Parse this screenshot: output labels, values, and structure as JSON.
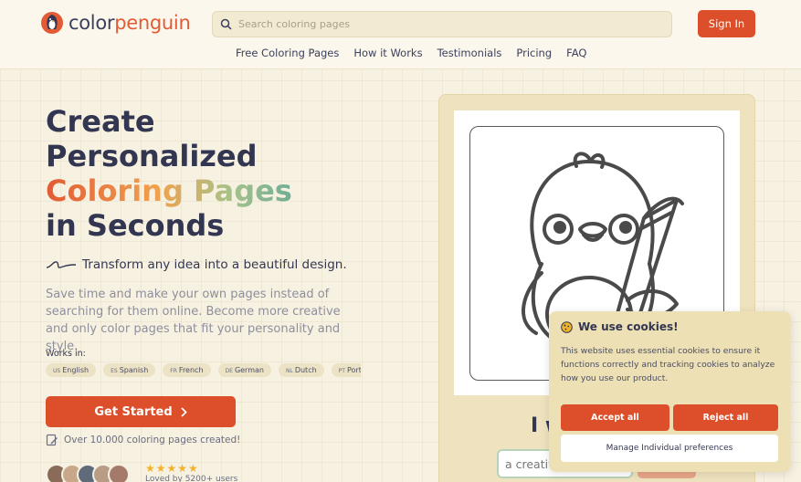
{
  "header": {
    "logo": {
      "part1": "color",
      "part2": "penguin"
    },
    "search": {
      "placeholder": "Search coloring pages"
    },
    "signin_label": "Sign In",
    "nav": [
      "Free Coloring Pages",
      "How it Works",
      "Testimonials",
      "Pricing",
      "FAQ"
    ]
  },
  "hero": {
    "title_line1": "Create",
    "title_line2": "Personalized",
    "title_line3": "Coloring Pages",
    "title_line4": "in Seconds",
    "tagline": "Transform any idea into a beautiful design.",
    "description": "Save time and make your own pages instead of searching for them online. Become more creative and only color pages that fit your personality and style.",
    "works_in": "Works in:",
    "languages": [
      {
        "code": "US",
        "name": "English"
      },
      {
        "code": "ES",
        "name": "Spanish"
      },
      {
        "code": "FR",
        "name": "French"
      },
      {
        "code": "DE",
        "name": "German"
      },
      {
        "code": "NL",
        "name": "Dutch"
      },
      {
        "code": "PT",
        "name": "Portug"
      }
    ],
    "cta_label": "Get Started",
    "created": "Over 10.000 coloring pages created!",
    "stars": "★★★★★",
    "loved_by": "Loved by 5200+ users"
  },
  "preview": {
    "heading_peek": "I w",
    "prompt_placeholder": "a creativ"
  },
  "cookie": {
    "title": "We use cookies!",
    "body": "This website uses essential cookies to ensure it functions correctly and tracking cookies to analyze how you use our product.",
    "accept_label": "Accept all",
    "reject_label": "Reject all",
    "manage_label": "Manage Individual preferences"
  },
  "colors": {
    "accent": "#dc4f2a",
    "background": "#f7f1e2",
    "text": "#333651"
  }
}
